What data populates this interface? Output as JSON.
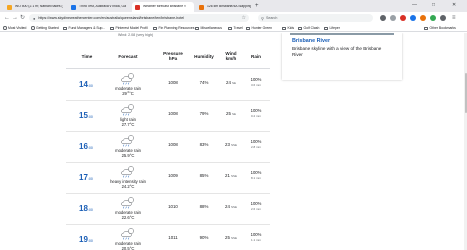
{
  "tabs": [
    {
      "title": "WO 500 (2.1 m; Nathani takes (×",
      "favicon_color": "#f5a623",
      "active": false
    },
    {
      "title": "Third Test, Australia v India, Ga ×",
      "favicon_color": "#1a73e8",
      "active": false
    },
    {
      "title": "Weather forecast Brisbane ×",
      "favicon_color": "#d93025",
      "active": true
    },
    {
      "title": "126 km Brisbane/4A Slapping/Pa ×",
      "favicon_color": "#e8710a",
      "active": false
    }
  ],
  "toolbar": {
    "url": "https://www.skydineweathercenter.com/en/australia/queensland/brisbane/ten/brisbane-hotel",
    "search_placeholder": "Search"
  },
  "bookmarks": [
    "Most Visited",
    "Getting Started",
    "Fund Managers & Sup...",
    "Pinterest Model Profil",
    "Fin Planning Resources",
    "Miscellaneous",
    "Travel",
    "Hunter Green",
    "Kids",
    "Golf Clash",
    "Lifeper",
    "Other Bookmarks"
  ],
  "page": {
    "gust_text": "Wind: 2.08 (very high)"
  },
  "headers": {
    "time": "Time",
    "forecast": "Forecast",
    "pressure": "Pressure hPa",
    "humidity": "Humidity",
    "wind": "Wind km/h",
    "rain": "Rain"
  },
  "rows": [
    {
      "hour": "14",
      "min": ":00",
      "desc": "moderate rain",
      "temp": "29",
      "unit": "°C",
      "temp_dec": ".0",
      "pressure": "1008",
      "humidity": "74%",
      "wind": "24",
      "wind_dir": "SE",
      "rain_pct": "100%",
      "rain_mm": "3.6 mm"
    },
    {
      "hour": "15",
      "min": ":00",
      "desc": "light rain",
      "temp": "27.7",
      "unit": "°C",
      "pressure": "1008",
      "humidity": "79%",
      "wind": "25",
      "wind_dir": "SE",
      "rain_pct": "100%",
      "rain_mm": "0.2 mm"
    },
    {
      "hour": "16",
      "min": ":00",
      "desc": "moderate rain",
      "temp": "25.9",
      "unit": "°C",
      "pressure": "1008",
      "humidity": "83%",
      "wind": "23",
      "wind_dir": "SSE",
      "rain_pct": "100%",
      "rain_mm": "2.8 mm"
    },
    {
      "hour": "17",
      "min": ":00",
      "desc": "heavy intensity rain",
      "temp": "24.2",
      "unit": "°C",
      "pressure": "1009",
      "humidity": "85%",
      "wind": "21",
      "wind_dir": "SSE",
      "rain_pct": "100%",
      "rain_mm": "8.1 mm"
    },
    {
      "hour": "18",
      "min": ":00",
      "desc": "moderate rain",
      "temp": "22.6",
      "unit": "°C",
      "pressure": "1010",
      "humidity": "88%",
      "wind": "24",
      "wind_dir": "SSE",
      "rain_pct": "100%",
      "rain_mm": "2.6 mm"
    },
    {
      "hour": "19",
      "min": ":00",
      "desc": "moderate rain",
      "temp": "20.5",
      "unit": "°C",
      "pressure": "1011",
      "humidity": "90%",
      "wind": "25",
      "wind_dir": "SSE",
      "rain_pct": "100%",
      "rain_mm": "1.1 mm"
    }
  ],
  "sidebar": {
    "title": "Brisbane River",
    "caption": "Brisbane skyline with a view of the Brisbane River"
  },
  "colors": {
    "accent_blue": "#1a5eb6",
    "tab_strip": "#e8e8ec"
  }
}
